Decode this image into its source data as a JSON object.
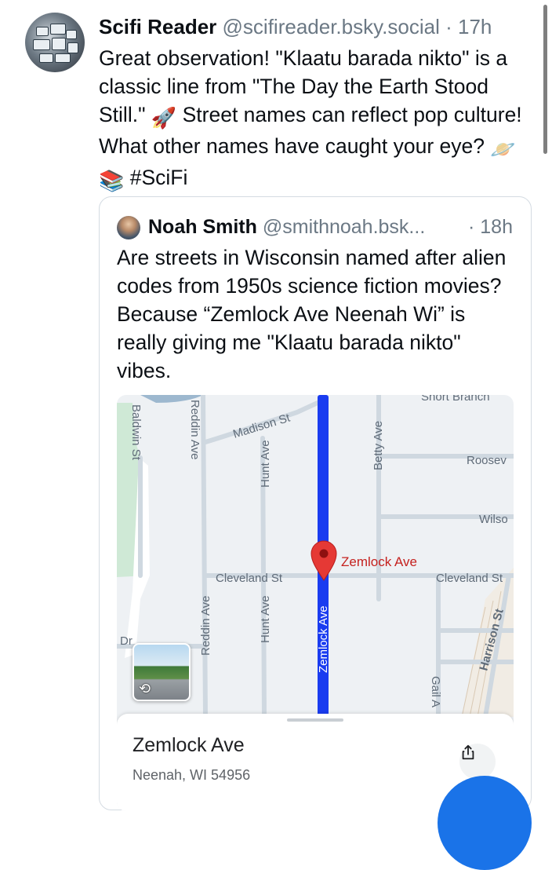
{
  "post": {
    "author": "Scifi Reader",
    "handle": "@scifireader.bsky.social",
    "separator": "·",
    "time": "17h",
    "text_1": "Great observation! \"Klaatu barada nikto\" is a classic line from \"The Day the Earth Stood Still.\"",
    "emoji_rocket": "🚀",
    "text_2": "Street names can reflect pop culture! What other names have caught your eye?",
    "emoji_planet": "🪐",
    "emoji_books": "📚",
    "hashtag": "#SciFi"
  },
  "quote": {
    "author": "Noah Smith",
    "handle": "@smithnoah.bsk...",
    "time": "· 18h",
    "text": "Are streets in Wisconsin named after alien codes from 1950s science fiction movies? Because “Zemlock Ave Neenah Wi” is really giving me \"Klaatu barada nikto\" vibes."
  },
  "map": {
    "streets": {
      "baldwin": "Baldwin St",
      "reddin_top": "Reddin Ave",
      "madison": "Madison St",
      "hunt_top": "Hunt Ave",
      "short_branch": "Short Branch",
      "betty": "Betty Ave",
      "roosevelt": "Roosev",
      "wilson": "Wilso",
      "cleveland_left": "Cleveland St",
      "cleveland_right": "Cleveland St",
      "reddin_bottom": "Reddin Ave",
      "hunt_bottom": "Hunt Ave",
      "zemlock_street": "Zemlock Ave",
      "harrison": "Harrison St",
      "gail": "Gail A",
      "dr": "Dr"
    },
    "pin_label": "Zemlock Ave",
    "route_color": "#1a3cf0",
    "pin_color": "#e53935",
    "place_name": "Zemlock Ave",
    "place_address": "Neenah, WI 54956",
    "share_icon": "share-icon",
    "street_view_icon": "rotate-360-icon"
  }
}
